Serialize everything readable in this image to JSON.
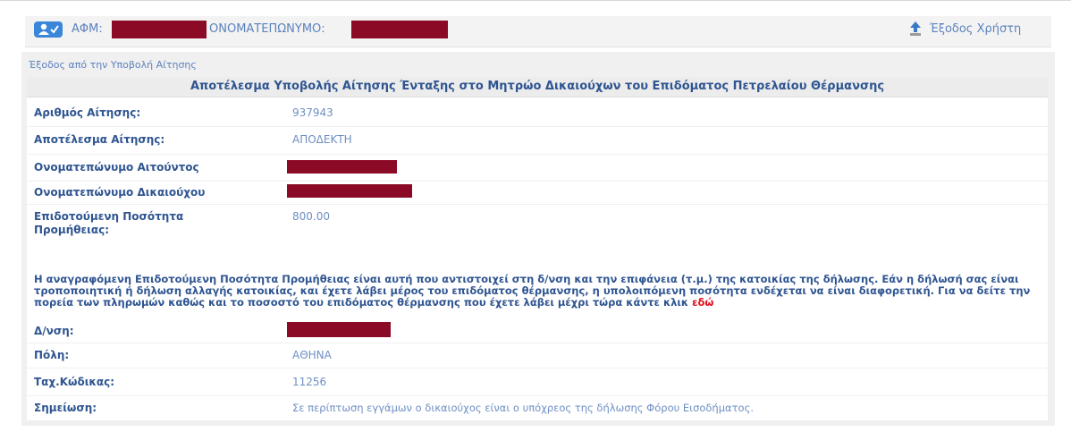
{
  "header": {
    "afm_label": "ΑΦΜ:",
    "name_label": "ΟΝΟΜΑΤΕΠΩΝΥΜΟ:",
    "exit_label": "Έξοδος Χρήστη",
    "icons": {
      "user": "user-check-icon",
      "exit": "exit-arrow-icon"
    }
  },
  "panel": {
    "back_link": "Έξοδος από την Υποβολή Αίτησης",
    "title": "Αποτέλεσμα Υποβολής Αίτησης Ένταξης στο Μητρώο Δικαιούχων του Επιδόματος Πετρελαίου Θέρμανσης",
    "fields": {
      "application_number": {
        "label": "Αριθμός Αίτησης:",
        "value": "937943"
      },
      "result": {
        "label": "Αποτέλεσμα Αίτησης:",
        "value": "ΑΠΟΔΕΚΤΗ"
      },
      "applicant": {
        "label": "Ονοματεπώνυμο Αιτούντος"
      },
      "beneficiary": {
        "label": "Ονοματεπώνυμο Δικαιούχου"
      },
      "quantity": {
        "label": "Επιδοτούμενη Ποσότητα Προμήθειας:",
        "value": "800.00"
      },
      "address": {
        "label": "Δ/νση:"
      },
      "city": {
        "label": "Πόλη:",
        "value": "ΑΘΗΝΑ"
      },
      "postal_code": {
        "label": "Ταχ.Κώδικας:",
        "value": "11256"
      },
      "remark": {
        "label": "Σημείωση:",
        "value": "Σε περίπτωση εγγάμων ο δικαιούχος είναι ο υπόχρεος της δήλωσης Φόρου Εισοδήματος."
      }
    },
    "note_text": "Η αναγραφόμενη Επιδοτούμενη Ποσότητα Προμήθειας είναι αυτή που αντιστοιχεί στη δ/νση και την επιφάνεια (τ.μ.) της κατοικίας της δήλωσης. Εάν η δήλωσή σας είναι τροποποιητική ή δήλωση αλλαγής κατοικίας, και έχετε λάβει μέρος του επιδόματος θέρμανσης, η υπολοιπόμενη ποσότητα ενδέχεται να είναι διαφορετική. Για να δείτε την πορεία των πληρωμών καθώς και το ποσοστό του επιδόματος θέρμανσης που έχετε λάβει μέχρι τώρα κάντε κλικ",
    "note_link": "εδώ"
  },
  "colors": {
    "redaction": "#8b0a25",
    "label": "#2f5591",
    "value": "#6e8fc4",
    "link": "#e0101c"
  }
}
